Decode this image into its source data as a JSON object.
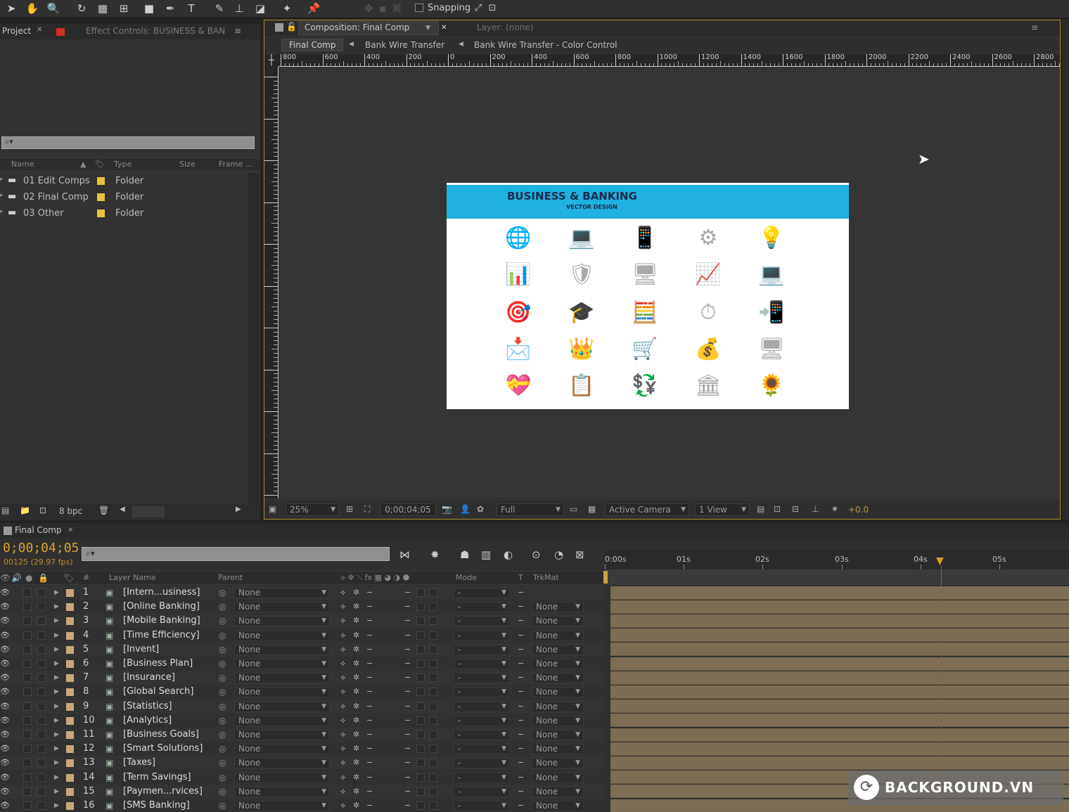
{
  "toolbar": {
    "snapping_label": "Snapping",
    "tools": [
      "selection-tool",
      "hand-tool",
      "zoom-tool",
      "rotate-tool",
      "camera-tool",
      "pan-behind-tool",
      "rectangle-tool",
      "pen-tool",
      "text-tool",
      "brush-tool",
      "clone-stamp-tool",
      "eraser-tool",
      "roto-brush-tool",
      "puppet-pin-tool"
    ]
  },
  "project_panel": {
    "tab_project": "Project",
    "tab_effect_controls": "Effect Controls: BUSINESS & BAN",
    "columns": {
      "name": "Name",
      "type": "Type",
      "size": "Size",
      "frame": "Frame ..."
    },
    "items": [
      {
        "name": "01 Edit Comps",
        "type": "Folder"
      },
      {
        "name": "02 Final Comp",
        "type": "Folder"
      },
      {
        "name": "03 Other",
        "type": "Folder"
      }
    ],
    "bpc": "8 bpc"
  },
  "composition_panel": {
    "tab_label": "Composition: Final Comp",
    "layer_tab": "Layer: (none)",
    "breadcrumbs": [
      "Final Comp",
      "Bank Wire Transfer",
      "Bank Wire Transfer - Color Control"
    ],
    "ruler_ticks": [
      "800",
      "600",
      "400",
      "200",
      "0",
      "200",
      "400",
      "600",
      "800",
      "1000",
      "1200",
      "1400",
      "1600",
      "1800",
      "2000",
      "2200",
      "2400",
      "2600",
      "2800"
    ],
    "artwork": {
      "title": "BUSINESS & BANKING",
      "subtitle": "VECTOR DESIGN",
      "header_color": "#1fb1e0"
    },
    "footer": {
      "zoom": "25%",
      "timecode": "0;00;04;05",
      "resolution": "Full",
      "camera": "Active Camera",
      "views": "1 View",
      "exposure": "+0.0"
    }
  },
  "timeline": {
    "tab_label": "Final Comp",
    "current_time": "0;00;04;05",
    "frame_info": "00125 (29.97 fps)",
    "columns": {
      "layer_name": "Layer Name",
      "parent": "Parent",
      "mode": "Mode",
      "t": "T",
      "trkmat": "TrkMat"
    },
    "time_marks": [
      "0:00s",
      "01s",
      "02s",
      "03s",
      "04s",
      "05s"
    ],
    "layers": [
      {
        "num": "1",
        "name": "[Intern...usiness]",
        "parent": "None",
        "trkmat": ""
      },
      {
        "num": "2",
        "name": "[Online Banking]",
        "parent": "None",
        "trkmat": "None"
      },
      {
        "num": "3",
        "name": "[Mobile Banking]",
        "parent": "None",
        "trkmat": "None"
      },
      {
        "num": "4",
        "name": "[Time Efficiency]",
        "parent": "None",
        "trkmat": "None"
      },
      {
        "num": "5",
        "name": "[Invent]",
        "parent": "None",
        "trkmat": "None"
      },
      {
        "num": "6",
        "name": "[Business Plan]",
        "parent": "None",
        "trkmat": "None"
      },
      {
        "num": "7",
        "name": "[Insurance]",
        "parent": "None",
        "trkmat": "None"
      },
      {
        "num": "8",
        "name": "[Global Search]",
        "parent": "None",
        "trkmat": "None"
      },
      {
        "num": "9",
        "name": "[Statistics]",
        "parent": "None",
        "trkmat": "None"
      },
      {
        "num": "10",
        "name": "[Analytics]",
        "parent": "None",
        "trkmat": "None"
      },
      {
        "num": "11",
        "name": "[Business Goals]",
        "parent": "None",
        "trkmat": "None"
      },
      {
        "num": "12",
        "name": "[Smart Solutions]",
        "parent": "None",
        "trkmat": "None"
      },
      {
        "num": "13",
        "name": "[Taxes]",
        "parent": "None",
        "trkmat": "None"
      },
      {
        "num": "14",
        "name": "[Term Savings]",
        "parent": "None",
        "trkmat": "None"
      },
      {
        "num": "15",
        "name": "[Paymen...rvices]",
        "parent": "None",
        "trkmat": "None"
      },
      {
        "num": "16",
        "name": "[SMS Banking]",
        "parent": "None",
        "trkmat": "None"
      }
    ],
    "mode_value": "-"
  },
  "watermark": {
    "text": "BACKGROUND.VN"
  }
}
